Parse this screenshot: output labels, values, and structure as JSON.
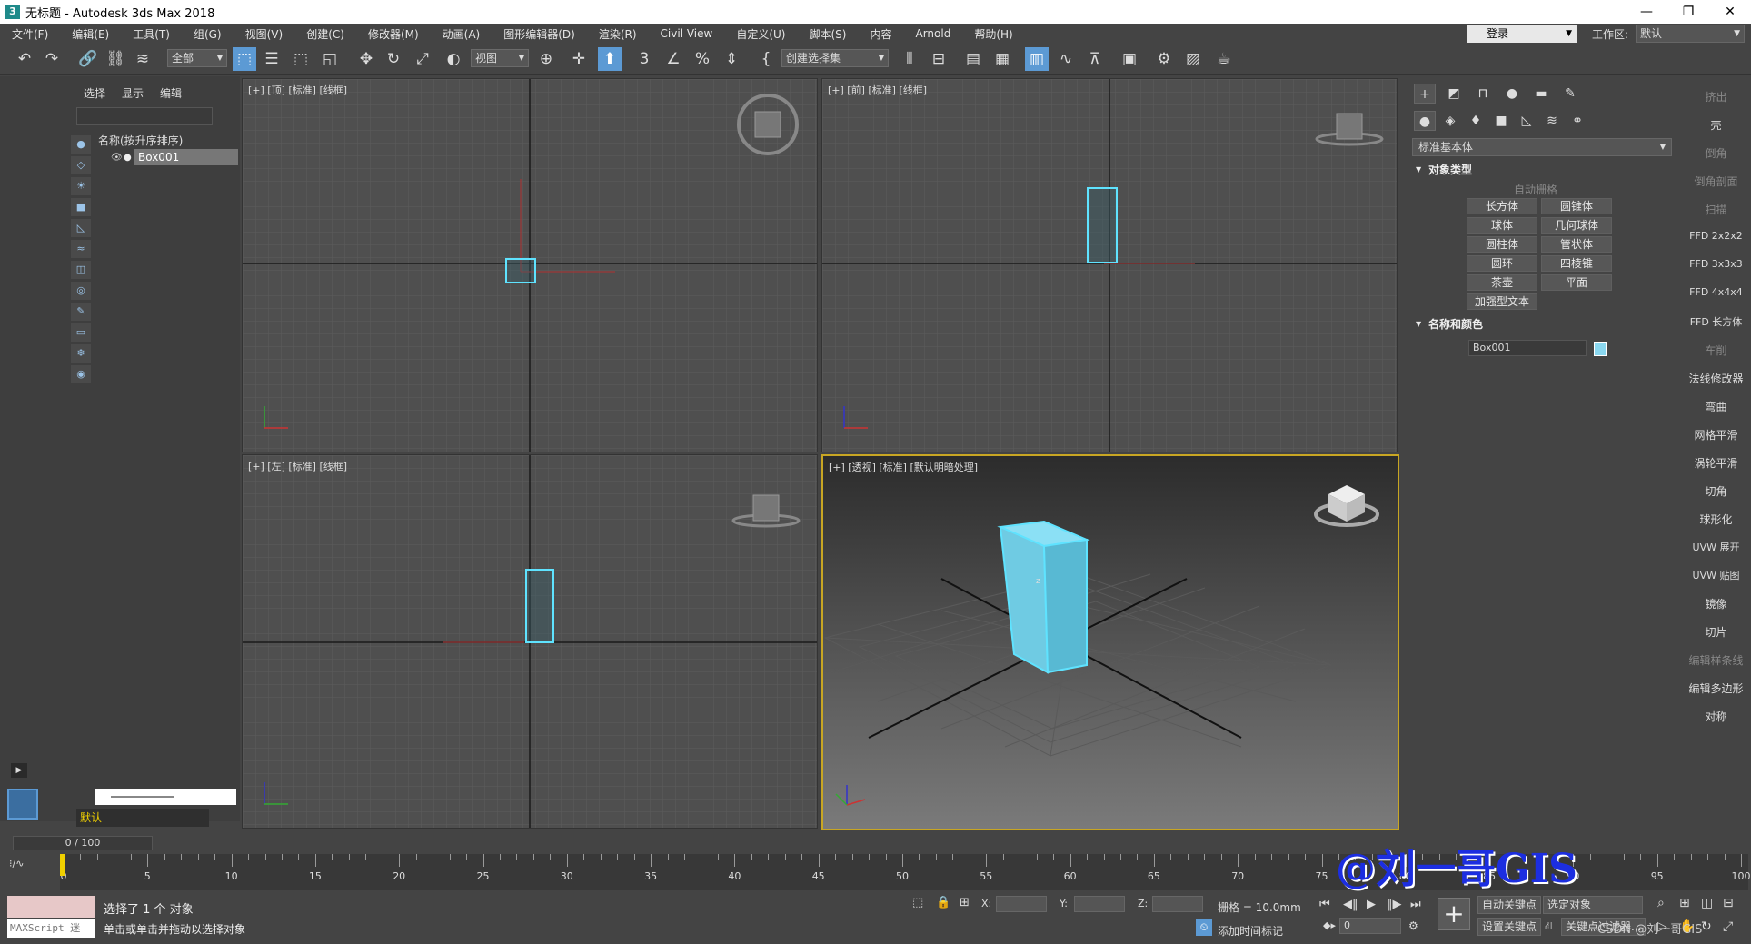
{
  "window": {
    "title": "无标题 - Autodesk 3ds Max 2018",
    "icon": "3"
  },
  "window_controls": [
    "—",
    "❐",
    "✕"
  ],
  "menu": [
    "文件(F)",
    "编辑(E)",
    "工具(T)",
    "组(G)",
    "视图(V)",
    "创建(C)",
    "修改器(M)",
    "动画(A)",
    "图形编辑器(D)",
    "渲染(R)",
    "Civil View",
    "自定义(U)",
    "脚本(S)",
    "内容",
    "Arnold",
    "帮助(H)"
  ],
  "account": {
    "login": "登录",
    "workspace_label": "工作区:",
    "workspace_value": "默认"
  },
  "toolbar": {
    "filter": "全部",
    "ref_coord": "视图",
    "named_selection": "创建选择集"
  },
  "scene_explorer": {
    "tabs": [
      "选择",
      "显示",
      "编辑"
    ],
    "column_header": "名称(按升序排序)",
    "objects": [
      {
        "name": "Box001"
      }
    ],
    "layer": "默认"
  },
  "viewports": {
    "top": {
      "label": "[+] [顶] [标准] [线框]"
    },
    "front": {
      "label": "[+] [前] [标准] [线框]"
    },
    "left": {
      "label": "[+] [左] [标准] [线框]"
    },
    "perspective": {
      "label": "[+] [透视] [标准] [默认明暗处理]"
    }
  },
  "command_panel": {
    "category": "标准基本体",
    "object_type_title": "对象类型",
    "autogrid": "自动栅格",
    "object_buttons": [
      "长方体",
      "圆锥体",
      "球体",
      "几何球体",
      "圆柱体",
      "管状体",
      "圆环",
      "四棱锥",
      "茶壶",
      "平面",
      "加强型文本"
    ],
    "name_color_title": "名称和颜色",
    "object_name": "Box001",
    "object_color": "#8ad8f0"
  },
  "modifier_list": [
    "挤出",
    "壳",
    "倒角",
    "倒角剖面",
    "扫描",
    "FFD 2x2x2",
    "FFD 3x3x3",
    "FFD 4x4x4",
    "FFD 长方体",
    "车削",
    "法线修改器",
    "弯曲",
    "网格平滑",
    "涡轮平滑",
    "切角",
    "球形化",
    "UVW 展开",
    "UVW 贴图",
    "镜像",
    "切片",
    "编辑样条线",
    "编辑多边形",
    "对称"
  ],
  "timeline": {
    "frame_display": "0 / 100",
    "tick_labels": [
      "0",
      "5",
      "10",
      "15",
      "20",
      "25",
      "30",
      "35",
      "40",
      "45",
      "50",
      "55",
      "60",
      "65",
      "70",
      "75",
      "80",
      "85",
      "90",
      "95",
      "100"
    ]
  },
  "status": {
    "maxscript": "MAXScript 迷",
    "selection": "选择了 1 个 对象",
    "prompt": "单击或单击并拖动以选择对象",
    "x_label": "X:",
    "y_label": "Y:",
    "z_label": "Z:",
    "grid": "栅格 = 10.0mm",
    "add_time_tag": "添加时间标记",
    "auto_key": "自动关键点",
    "selected_object": "选定对象",
    "set_key": "设置关键点",
    "key_filter": "关键点过滤器...",
    "frame": "0"
  },
  "watermark": "@刘一哥GIS",
  "csdn_credit": "CSDN @刘一哥GIS"
}
